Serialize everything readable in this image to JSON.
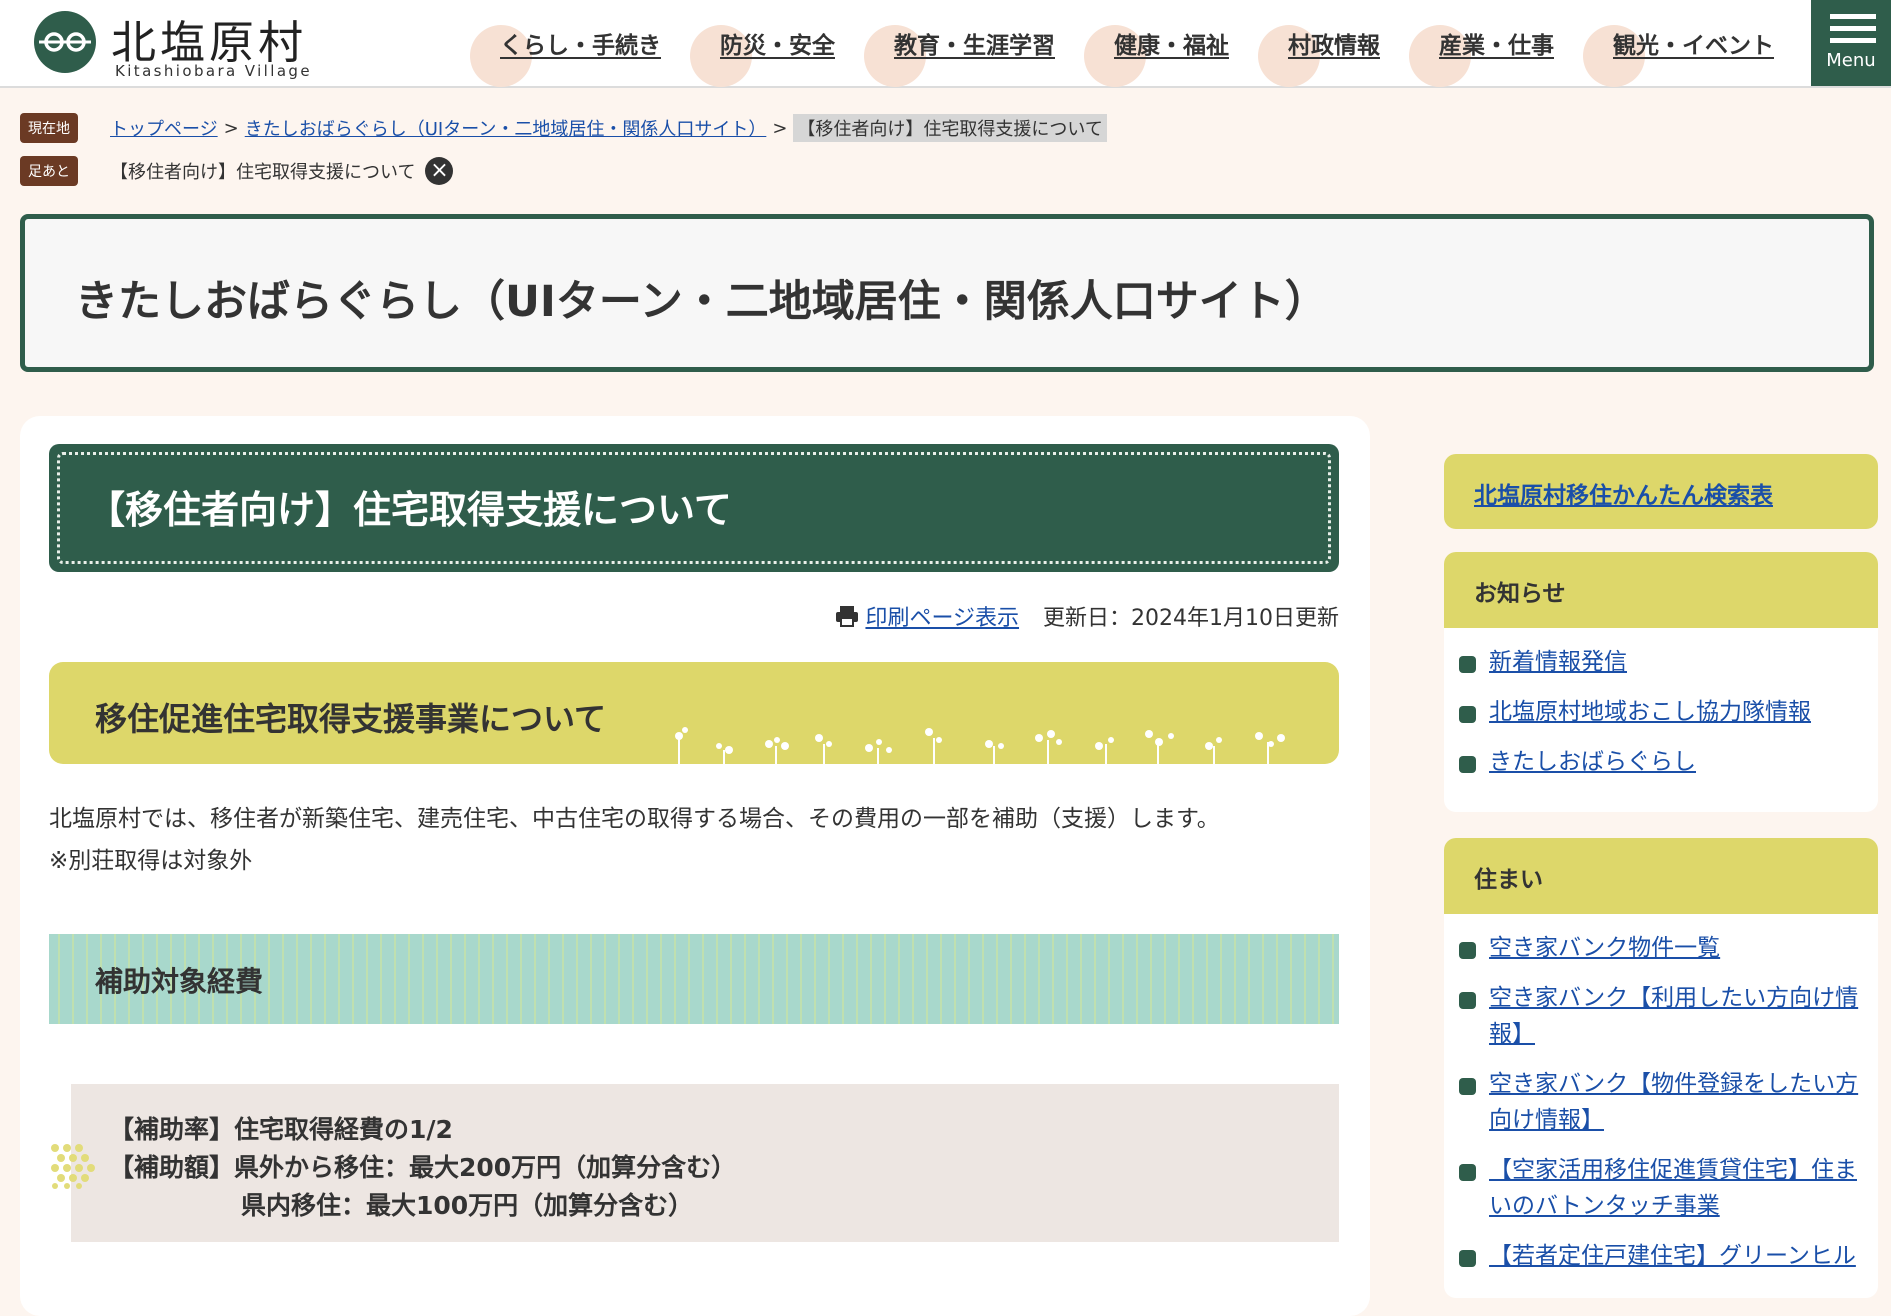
{
  "header": {
    "logo_jp": "北塩原村",
    "logo_en": "Kitashiobara Village",
    "nav": [
      {
        "label": "くらし・手続き"
      },
      {
        "label": "防災・安全"
      },
      {
        "label": "教育・生涯学習"
      },
      {
        "label": "健康・福祉"
      },
      {
        "label": "村政情報"
      },
      {
        "label": "産業・仕事"
      },
      {
        "label": "観光・イベント"
      }
    ],
    "menu_label": "Menu"
  },
  "breadcrumb": {
    "tag": "現在地",
    "links": [
      "トップページ",
      "きたしおばらぐらし（UIターン・二地域居住・関係人口サイト）"
    ],
    "separator": ">",
    "current": "【移住者向け】住宅取得支援について"
  },
  "ashiato": {
    "tag": "足あと",
    "item": "【移住者向け】住宅取得支援について",
    "close": "×"
  },
  "section_banner": "きたしおばらぐらし（UIターン・二地域居住・関係人口サイト）",
  "main": {
    "title": "【移住者向け】住宅取得支援について",
    "print_label": "印刷ページ表示",
    "updated": "更新日：2024年1月10日更新",
    "h3": "移住促進住宅取得支援事業について",
    "lead_1": "北塩原村では、移住者が新築住宅、建売住宅、中古住宅の取得する場合、その費用の一部を補助（支援）します。",
    "lead_2": "※別荘取得は対象外",
    "h4": "補助対象経費",
    "info_1": "【補助率】住宅取得経費の1/2",
    "info_2": "【補助額】県外から移住：最大200万円（加算分含む）",
    "info_3": "県内移住：最大100万円（加算分含む）"
  },
  "side": {
    "top_link": "北塩原村移住かんたん検索表",
    "oshirase": {
      "title": "お知らせ",
      "items": [
        "新着情報発信",
        "北塩原村地域おこし協力隊情報",
        "きたしおばらぐらし"
      ]
    },
    "sumai": {
      "title": "住まい",
      "items": [
        "空き家バンク物件一覧",
        "空き家バンク【利用したい方向け情報】",
        "空き家バンク【物件登録をしたい方向け情報】",
        "【空家活用移住促進賃貸住宅】住まいのバトンタッチ事業",
        "【若者定住戸建住宅】グリーンヒル"
      ]
    }
  },
  "colors": {
    "brand_green": "#2f5d4b",
    "yellow": "#ddd76a",
    "mint": "#a8d8cc",
    "link": "#1a4fa8",
    "crumb_tag": "#6b3a24"
  }
}
